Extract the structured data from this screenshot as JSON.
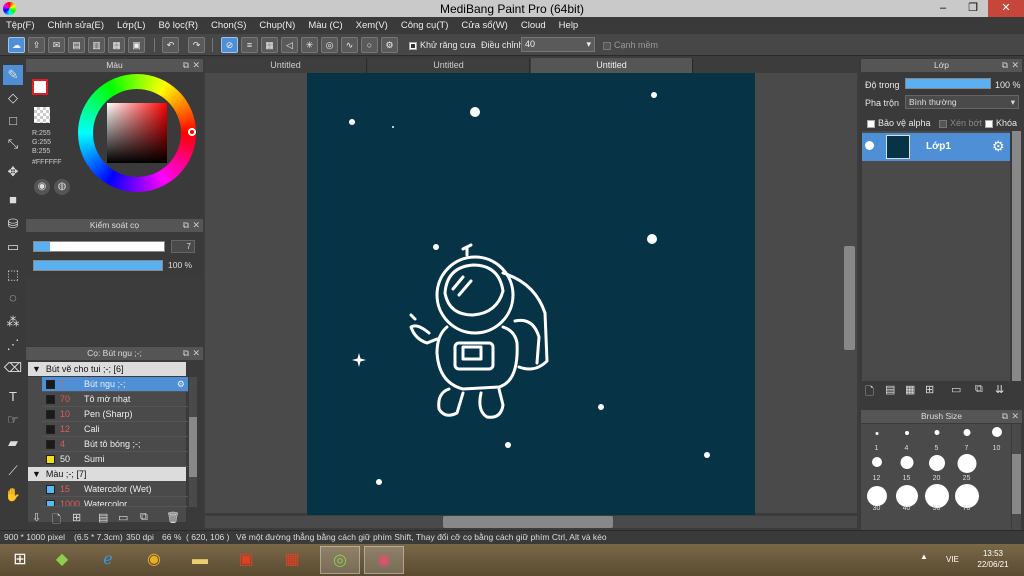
{
  "app": {
    "title": "MediBang Paint Pro (64bit)"
  },
  "menu": [
    "Tệp(F)",
    "Chỉnh sửa(E)",
    "Lớp(L)",
    "Bộ lọc(R)",
    "Chọn(S)",
    "Chụp(N)",
    "Màu (C)",
    "Xem(V)",
    "Công cụ(T)",
    "Cửa sổ(W)",
    "Cloud",
    "Help"
  ],
  "toolbar": {
    "antialias_label": "Khử răng cưa",
    "adjust_label": "Điều chỉnh",
    "adjust_value": "40",
    "smooth_edge_label": "Cạnh mềm"
  },
  "tabs": [
    "Untitled",
    "Untitled",
    "Untitled"
  ],
  "color_panel": {
    "title": "Màu",
    "r": "R:255",
    "g": "G:255",
    "b": "B:255",
    "hex": "#FFFFFF"
  },
  "brush_control": {
    "title": "Kiểm soát cọ",
    "size": "7",
    "opacity": "100 %"
  },
  "brush_panel": {
    "title": "Cọ: Bút ngu ;-;",
    "group1": "Bút vẽ cho tui ;-; [6]",
    "items": [
      {
        "num": "7",
        "name": "Bút ngu ;-;",
        "color": "#1a1a1a"
      },
      {
        "num": "70",
        "name": "Tô mờ nhạt",
        "color": "#1a1a1a"
      },
      {
        "num": "10",
        "name": "Pen (Sharp)",
        "color": "#1a1a1a"
      },
      {
        "num": "12",
        "name": "Cali",
        "color": "#1a1a1a"
      },
      {
        "num": "4",
        "name": "Bút tô bóng ;-;",
        "color": "#1a1a1a"
      },
      {
        "num": "50",
        "name": "Sumi",
        "color": "#f0e020"
      }
    ],
    "group2": "Màu ;-; [7]",
    "items2": [
      {
        "num": "15",
        "name": "Watercolor (Wet)",
        "color": "#5ab8f0"
      },
      {
        "num": "1000",
        "name": "Watercolor",
        "color": "#5ab8f0"
      }
    ]
  },
  "layer_panel": {
    "title": "Lớp",
    "opacity_label": "Độ trong",
    "opacity_value": "100 %",
    "blend_label": "Pha trộn",
    "blend_value": "Bình thường",
    "protect_alpha": "Bảo vệ alpha",
    "clip": "Xén bớt",
    "lock": "Khóa",
    "layer_name": "Lớp1"
  },
  "brush_size": {
    "title": "Brush Size",
    "sizes": [
      "1",
      "4",
      "5",
      "7",
      "10",
      "12",
      "15",
      "20",
      "25",
      "30",
      "40",
      "50",
      "70"
    ]
  },
  "status": {
    "dims": "900 * 1000 pixel",
    "cm": "(6.5 * 7.3cm)",
    "dpi": "350 dpi",
    "zoom": "66 %",
    "coords": "( 620, 106 )",
    "hint": "Vẽ một đường thẳng bằng cách giữ phím Shift, Thay đổi cỡ cọ bằng cách giữ phím Ctrl, Alt và kéo"
  },
  "taskbar": {
    "lang": "VIE",
    "time": "13:53",
    "date": "22/06/21"
  },
  "colors": {
    "canvas": "#073347",
    "accent": "#4f8fd6"
  }
}
